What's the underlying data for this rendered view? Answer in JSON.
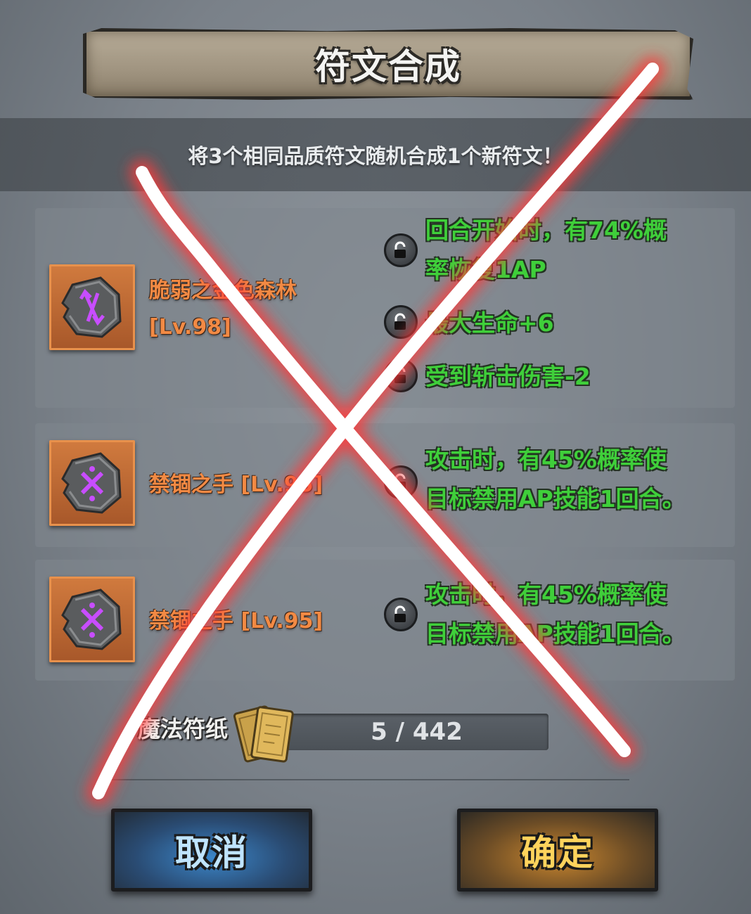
{
  "dialog": {
    "title": "符文合成",
    "subtitle": "将3个相同品质符文随机合成1个新符文！"
  },
  "runes": [
    {
      "name": "脆弱之金色森林",
      "level": "[Lv.98]",
      "rune_icon": "purple-arrows-rune-icon",
      "effects": [
        "回合开始时，有74%概",
        "率恢复1AP",
        "最大生命+6",
        "受到斩击伤害-2"
      ]
    },
    {
      "name": "禁锢之手 [Lv.95]",
      "rune_icon": "purple-cross-rune-icon",
      "effects": [
        "攻击时，有45%概率使",
        "目标禁用AP技能1回合。"
      ]
    },
    {
      "name": "禁锢之手 [Lv.95]",
      "rune_icon": "purple-cross-rune-icon",
      "effects": [
        "攻击时，有45%概率使",
        "目标禁用AP技能1回合。"
      ]
    }
  ],
  "material": {
    "label": "魔法符纸",
    "icon": "magic-paper-icon",
    "count": "5 / 442"
  },
  "buttons": {
    "cancel": "取消",
    "confirm": "确定"
  },
  "overlay": {
    "icon": "red-glow-x-mark"
  },
  "colors": {
    "rune_name": "#f28a44",
    "effect_text": "#3fcf3a",
    "cancel_button": "#3b86c9",
    "confirm_button": "#c9862e",
    "x_mark_glow": "#ff3b3b"
  }
}
